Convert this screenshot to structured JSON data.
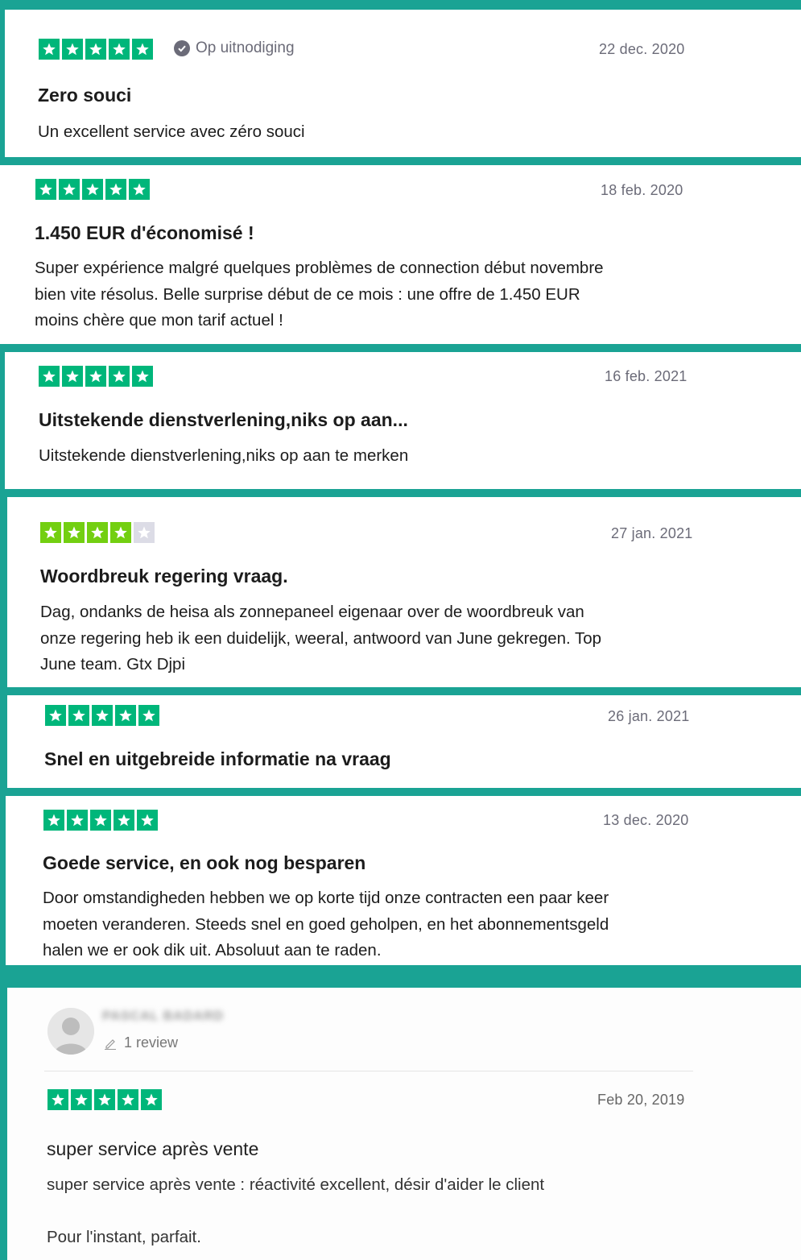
{
  "colors": {
    "background": "#1aa394",
    "star_full": "#00b67a",
    "star_four": "#73cf11",
    "star_empty": "#dcdce6"
  },
  "reviews": [
    {
      "rating": 5,
      "verified_label": "Op uitnodiging",
      "date": "22 dec. 2020",
      "title": "Zero souci",
      "body": [
        "Un excellent service avec zéro souci"
      ]
    },
    {
      "rating": 5,
      "date": "18 feb. 2020",
      "title": "1.450 EUR d'économisé !",
      "body": [
        "Super expérience malgré quelques problèmes de connection début novembre",
        "bien vite résolus. Belle surprise début de ce mois : une offre de 1.450 EUR",
        "moins chère que mon tarif actuel !"
      ]
    },
    {
      "rating": 5,
      "date": "16 feb. 2021",
      "title": "Uitstekende dienstverlening,niks op aan...",
      "body": [
        "Uitstekende dienstverlening,niks op aan te merken"
      ]
    },
    {
      "rating": 4,
      "date": "27 jan. 2021",
      "title": "Woordbreuk regering vraag.",
      "body": [
        "Dag, ondanks de heisa als zonnepaneel eigenaar over de woordbreuk van",
        "onze regering heb ik een duidelijk, weeral, antwoord van June gekregen. Top",
        "June team. Gtx Djpi"
      ]
    },
    {
      "rating": 5,
      "date": "26 jan. 2021",
      "title": "Snel en uitgebreide informatie na vraag",
      "body": []
    },
    {
      "rating": 5,
      "date": "13 dec. 2020",
      "title": "Goede service, en ook nog besparen",
      "body": [
        "Door omstandigheden hebben we op korte tijd onze contracten een paar keer",
        "moeten veranderen. Steeds snel en goed geholpen, en het abonnementsgeld",
        "halen we er ook dik uit. Absoluut aan te raden."
      ]
    },
    {
      "rating": 5,
      "reviewer_name": "PASCAL BADARD",
      "review_count": "1 review",
      "date": "Feb 20, 2019",
      "title": "super service après vente",
      "body": [
        "super service après vente : réactivité excellent, désir d'aider le client",
        "",
        "Pour l'instant, parfait."
      ]
    }
  ]
}
